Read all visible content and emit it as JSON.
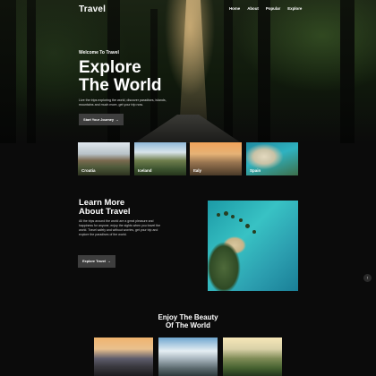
{
  "header": {
    "logo": "Travel",
    "nav": [
      "Home",
      "About",
      "Popular",
      "Explore"
    ]
  },
  "hero": {
    "welcome": "Welcome To Travel",
    "headline_line1": "Explore",
    "headline_line2": "The World",
    "description": "Live the trips exploring the world, discover paradises, islands, mountains and much more, get your trip now.",
    "button": "Start Your Journey",
    "button_icon": "arrow-right-icon"
  },
  "destinations": [
    {
      "label": "Croatia"
    },
    {
      "label": "Iceland"
    },
    {
      "label": "Italy"
    },
    {
      "label": "Spain"
    }
  ],
  "about": {
    "title_line1": "Learn More",
    "title_line2": "About Travel",
    "text": "All the trips around the world are a great pleasure and happiness for anyone, enjoy the sights when you travel the world. Travel safely and without worries, get your trip and explore the paradises of the world.",
    "button": "Explore Travel",
    "button_icon": "arrow-right-icon"
  },
  "scroll_top": {
    "icon": "arrow-up-icon",
    "glyph": "↑"
  },
  "gallery": {
    "title_line1": "Enjoy The Beauty",
    "title_line2": "Of The World"
  },
  "colors": {
    "background": "#0b0b0b",
    "button": "#3e3e3e",
    "text": "#ffffff"
  }
}
